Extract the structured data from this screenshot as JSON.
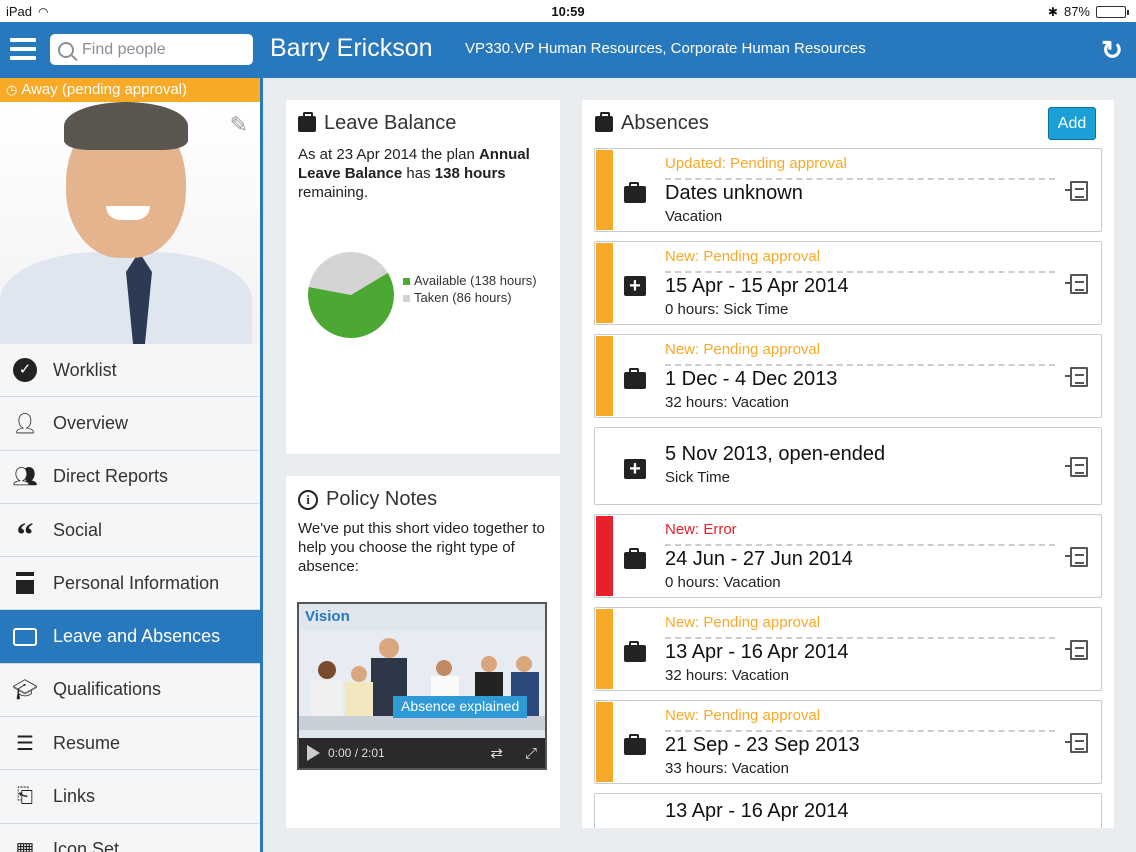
{
  "status_bar": {
    "device": "iPad",
    "time": "10:59",
    "battery": "87%",
    "battery_level": 0.87
  },
  "header": {
    "search_placeholder": "Find people",
    "name": "Barry Erickson",
    "role": "VP330.VP Human Resources, Corporate Human Resources",
    "icons": {
      "menu": "hamburger-icon",
      "search": "search-icon",
      "refresh": "refresh-icon"
    }
  },
  "profile": {
    "status": "Away (pending approval)",
    "status_color": "#f7a928"
  },
  "sidebar": {
    "items": [
      {
        "label": "Worklist",
        "icon": "check-circle-icon"
      },
      {
        "label": "Overview",
        "icon": "person-icon"
      },
      {
        "label": "Direct Reports",
        "icon": "people-icon"
      },
      {
        "label": "Social",
        "icon": "quote-icon"
      },
      {
        "label": "Personal Information",
        "icon": "id-card-icon"
      },
      {
        "label": "Leave and Absences",
        "icon": "briefcase-icon",
        "active": true
      },
      {
        "label": "Qualifications",
        "icon": "graduation-cap-icon"
      },
      {
        "label": "Resume",
        "icon": "document-list-icon"
      },
      {
        "label": "Links",
        "icon": "link-box-icon"
      },
      {
        "label": "Icon Set",
        "icon": "icon-set-icon"
      }
    ]
  },
  "leave_balance": {
    "title": "Leave Balance",
    "text_prefix": "As at 23 Apr 2014 the plan ",
    "plan_name": "Annual Leave Balance",
    "text_middle": " has ",
    "hours": "138 hours",
    "text_suffix": " remaining.",
    "legend": [
      {
        "label": "Available (138 hours)",
        "color": "#4ca832"
      },
      {
        "label": "Taken (86 hours)",
        "color": "#d4d4d4"
      }
    ]
  },
  "chart_data": {
    "type": "pie",
    "categories": [
      "Available (138 hours)",
      "Taken (86 hours)"
    ],
    "values": [
      138,
      86
    ],
    "colors": [
      "#4ca832",
      "#d4d4d4"
    ],
    "legend": "right"
  },
  "policy_notes": {
    "title": "Policy Notes",
    "text": "We've put this short video together to help you choose the right type of absence:",
    "video": {
      "brand": "Vision",
      "caption": "Absence explained",
      "current_time": "0:00",
      "duration": "2:01"
    }
  },
  "absences": {
    "title": "Absences",
    "add_label": "Add",
    "items": [
      {
        "status": "Updated: Pending approval",
        "status_color": "#f7a928",
        "dates": "Dates unknown",
        "detail": "Vacation",
        "type_icon": "briefcase-icon"
      },
      {
        "status": "New: Pending approval",
        "status_color": "#f7a928",
        "dates": "15 Apr - 15 Apr 2014",
        "detail": "0 hours: Sick Time",
        "type_icon": "medical-cross-icon"
      },
      {
        "status": "New: Pending approval",
        "status_color": "#f7a928",
        "dates": "1 Dec - 4 Dec 2013",
        "detail": "32 hours: Vacation",
        "type_icon": "briefcase-icon"
      },
      {
        "status": "",
        "status_color": "",
        "dates": "5 Nov 2013, open-ended",
        "detail": "Sick Time",
        "type_icon": "medical-cross-icon"
      },
      {
        "status": "New: Error",
        "status_color": "#e8202a",
        "dates": "24 Jun - 27 Jun 2014",
        "detail": "0 hours: Vacation",
        "type_icon": "briefcase-icon"
      },
      {
        "status": "New: Pending approval",
        "status_color": "#f7a928",
        "dates": "13 Apr - 16 Apr 2014",
        "detail": "32 hours: Vacation",
        "type_icon": "briefcase-icon"
      },
      {
        "status": "New: Pending approval",
        "status_color": "#f7a928",
        "dates": "21 Sep - 23 Sep 2013",
        "detail": "33 hours: Vacation",
        "type_icon": "briefcase-icon"
      },
      {
        "status": "",
        "status_color": "",
        "dates": "13 Apr - 16 Apr 2014",
        "detail": "",
        "type_icon": ""
      }
    ]
  }
}
